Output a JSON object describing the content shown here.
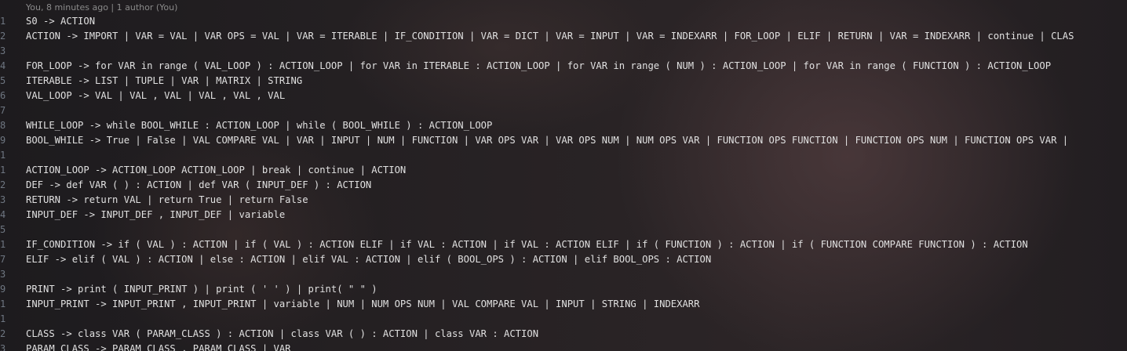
{
  "editor": {
    "blame": "You, 8 minutes ago | 1 author (You)",
    "lines": [
      {
        "num": "1",
        "text": "S0 -> ACTION"
      },
      {
        "num": "2",
        "text": "ACTION -> IMPORT | VAR = VAL | VAR OPS = VAL | VAR = ITERABLE | IF_CONDITION | VAR = DICT | VAR = INPUT | VAR = INDEXARR | FOR_LOOP | ELIF | RETURN | VAR = INDEXARR | continue | CLAS"
      },
      {
        "num": "3",
        "text": ""
      },
      {
        "num": "4",
        "text": "FOR_LOOP -> for VAR in range ( VAL_LOOP ) : ACTION_LOOP | for VAR in ITERABLE : ACTION_LOOP | for VAR in range ( NUM ) : ACTION_LOOP | for VAR in range ( FUNCTION ) : ACTION_LOOP"
      },
      {
        "num": "5",
        "text": "ITERABLE -> LIST | TUPLE | VAR | MATRIX | STRING"
      },
      {
        "num": "6",
        "text": "VAL_LOOP -> VAL | VAL , VAL | VAL , VAL , VAL"
      },
      {
        "num": "7",
        "text": ""
      },
      {
        "num": "8",
        "text": "WHILE_LOOP -> while BOOL_WHILE : ACTION_LOOP | while ( BOOL_WHILE ) : ACTION_LOOP"
      },
      {
        "num": "9",
        "text": "BOOL_WHILE -> True | False | VAL COMPARE VAL | VAR | INPUT | NUM | FUNCTION | VAR OPS VAR | VAR OPS NUM | NUM OPS VAR | FUNCTION OPS FUNCTION | FUNCTION OPS NUM | FUNCTION OPS VAR |"
      },
      {
        "num": "1",
        "text": ""
      },
      {
        "num": "1",
        "text": "ACTION_LOOP -> ACTION_LOOP ACTION_LOOP | break | continue | ACTION"
      },
      {
        "num": "2",
        "text": "DEF -> def VAR ( ) : ACTION | def VAR ( INPUT_DEF ) : ACTION"
      },
      {
        "num": "3",
        "text": "RETURN -> return VAL | return True | return False"
      },
      {
        "num": "4",
        "text": "INPUT_DEF -> INPUT_DEF , INPUT_DEF | variable"
      },
      {
        "num": "5",
        "text": ""
      },
      {
        "num": "1",
        "text": "IF_CONDITION -> if ( VAL ) : ACTION | if ( VAL ) : ACTION ELIF | if VAL : ACTION | if VAL : ACTION ELIF | if ( FUNCTION ) : ACTION | if ( FUNCTION COMPARE FUNCTION ) : ACTION"
      },
      {
        "num": "7",
        "text": "ELIF -> elif ( VAL ) : ACTION | else : ACTION | elif VAL : ACTION | elif ( BOOL_OPS ) : ACTION | elif BOOL_OPS : ACTION"
      },
      {
        "num": "3",
        "text": ""
      },
      {
        "num": "9",
        "text": "PRINT -> print ( INPUT_PRINT ) | print ( ' ' ) | print( \" \" )"
      },
      {
        "num": "1",
        "text": "INPUT_PRINT -> INPUT_PRINT , INPUT_PRINT | variable | NUM | NUM OPS NUM | VAL COMPARE VAL | INPUT | STRING | INDEXARR"
      },
      {
        "num": "1",
        "text": ""
      },
      {
        "num": "2",
        "text": "CLASS -> class VAR ( PARAM_CLASS ) : ACTION | class VAR ( ) : ACTION | class VAR : ACTION"
      },
      {
        "num": "3",
        "text": "PARAM_CLASS -> PARAM_CLASS , PARAM_CLASS | VAR"
      }
    ]
  }
}
